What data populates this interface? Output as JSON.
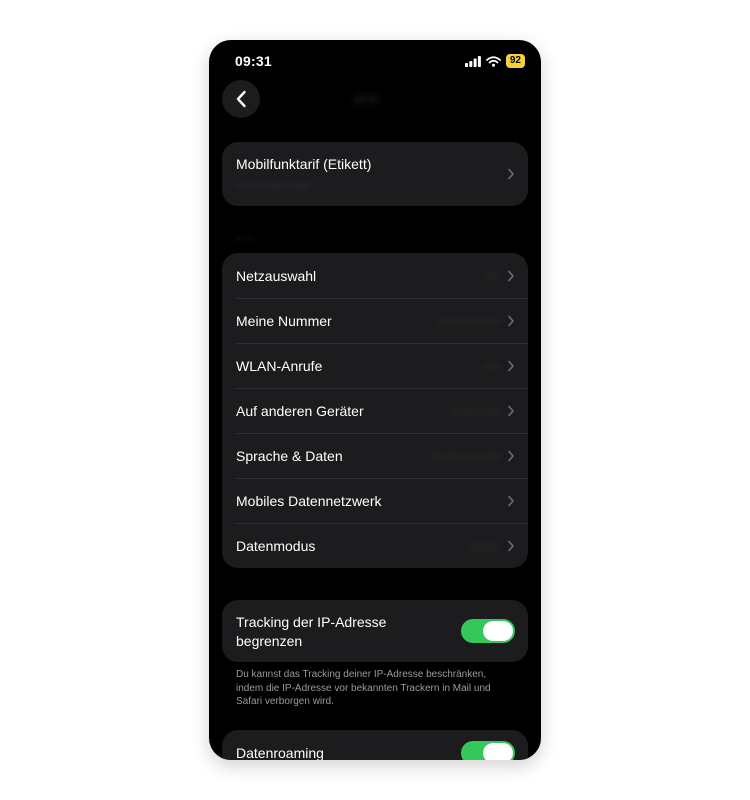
{
  "status_bar": {
    "time": "09:31",
    "battery": "92"
  },
  "nav": {
    "title": "·· ··"
  },
  "plan": {
    "title": "Mobilfunktarif (Etikett)",
    "subtitle": "··· ··· ····· ·····"
  },
  "section_header": "·· ··",
  "settings": {
    "rows": [
      {
        "label": "Netzauswahl",
        "value": "····"
      },
      {
        "label": "Meine Nummer",
        "value": "··· ··· ··· ····"
      },
      {
        "label": "WLAN-Anrufe",
        "value": "····"
      },
      {
        "label": "Auf anderen Geräter",
        "value": "·· ···· ·····"
      },
      {
        "label": "Sprache & Daten",
        "value": "··· ···· ··· ·····"
      },
      {
        "label": "Mobiles Datennetzwerk",
        "value": ""
      },
      {
        "label": "Datenmodus",
        "value": "········"
      }
    ]
  },
  "tracking": {
    "label_line1": "Tracking der IP-Adresse",
    "label_line2": "begrenzen",
    "enabled": true,
    "footnote": "Du kannst das Tracking deiner IP-Adresse beschrän­ken, indem die IP-Adresse vor bekannten Trackern in Mail und Safari verborgen wird."
  },
  "roaming": {
    "label": "Datenroaming",
    "enabled": true
  },
  "colors": {
    "toggle_on": "#34c759",
    "card_bg": "#1c1c1e",
    "battery": "#f5d23a"
  }
}
